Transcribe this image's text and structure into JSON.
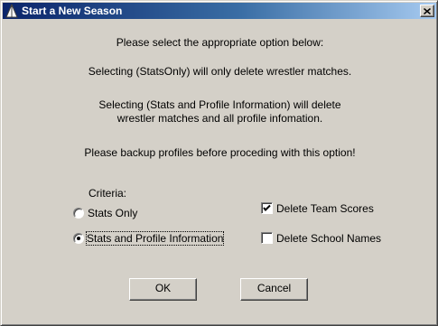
{
  "window": {
    "title": "Start a New Season",
    "close_glyph": "×",
    "icon": "app-triangle-icon"
  },
  "message": {
    "line1": "Please select the appropriate option below:",
    "line2": "Selecting (StatsOnly) will only delete wrestler matches.",
    "line3a": "Selecting (Stats and Profile Information) will delete",
    "line3b": "wrestler matches and all profile infomation.",
    "line4": "Please backup profiles before proceding with this option!"
  },
  "criteria": {
    "label": "Criteria:",
    "options": [
      {
        "label": "Stats Only",
        "selected": false
      },
      {
        "label": "Stats and Profile Information",
        "selected": true
      }
    ]
  },
  "checks": [
    {
      "label": "Delete Team Scores",
      "checked": true
    },
    {
      "label": "Delete School Names",
      "checked": false
    }
  ],
  "buttons": {
    "ok": "OK",
    "cancel": "Cancel"
  },
  "colors": {
    "face": "#d4d0c8",
    "title_active": "#0a246a",
    "title_gradient_end": "#a6caf0"
  }
}
